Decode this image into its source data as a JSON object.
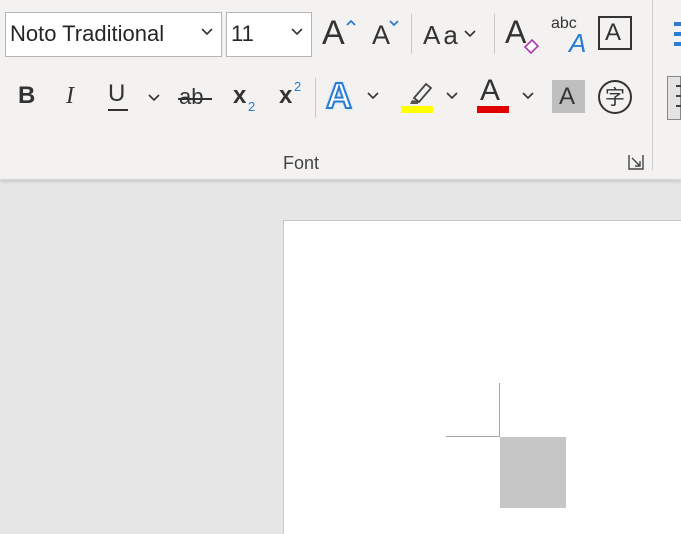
{
  "font_group": {
    "font_name": "Noto Traditional",
    "font_size": "11",
    "change_case_label": "Aa",
    "group_label": "Font",
    "grow_glyph": "A",
    "shrink_glyph": "A",
    "clear_glyph": "A",
    "phonetic_top": "abc",
    "phonetic_glyph": "A",
    "box_glyph": "A",
    "bold": "B",
    "italic": "I",
    "underline": "U",
    "strike": "ab",
    "subscript_base": "x",
    "subscript_mark": "2",
    "superscript_base": "x",
    "superscript_mark": "2",
    "effects_glyph": "A",
    "font_color_glyph": "A",
    "shading_glyph": "A",
    "enclose_glyph": "字"
  },
  "colors": {
    "highlight": "#ffff00",
    "font_color": "#e00000",
    "accent": "#2b7cd3",
    "ribbon_bg": "#f3f2f1",
    "canvas_bg": "#e6e6e6"
  }
}
